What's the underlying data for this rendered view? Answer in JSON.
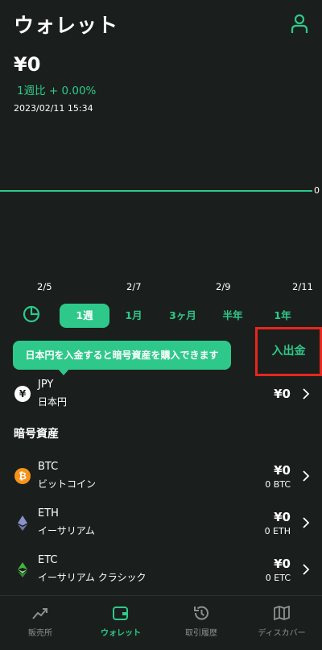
{
  "header": {
    "title": "ウォレット",
    "account_icon": "person-icon"
  },
  "summary": {
    "balance": "¥0",
    "weekly_change": "1週比 + 0.00%",
    "timestamp": "2023/02/11 15:34"
  },
  "chart": {
    "zero_label": "0",
    "x_ticks": [
      "2/5",
      "2/7",
      "2/9",
      "2/11"
    ]
  },
  "chart_data": {
    "type": "line",
    "x": [
      "2/5",
      "2/7",
      "2/9",
      "2/11"
    ],
    "series": [
      {
        "values": [
          0,
          0,
          0,
          0
        ]
      }
    ],
    "yticks": [
      "0"
    ]
  },
  "periods": {
    "pie_icon": "pie-chart-icon",
    "items": [
      "1週",
      "1月",
      "3ヶ月",
      "半年",
      "1年"
    ],
    "selected": "1週"
  },
  "tooltip": {
    "text": "日本円を入金すると暗号資産を購入できます"
  },
  "deposit": {
    "label": "入出金"
  },
  "jpy": {
    "symbol": "JPY",
    "name": "日本円",
    "amount": "¥0",
    "icon_glyph": "¥"
  },
  "crypto_section": {
    "title": "暗号資産"
  },
  "assets": [
    {
      "symbol": "BTC",
      "name": "ビットコイン",
      "amount": "¥0",
      "quantity": "0 BTC",
      "icon": "bitcoin-icon",
      "color": "#f7931a"
    },
    {
      "symbol": "ETH",
      "name": "イーサリアム",
      "amount": "¥0",
      "quantity": "0 ETH",
      "icon": "ethereum-icon",
      "color": "#8a93c9"
    },
    {
      "symbol": "ETC",
      "name": "イーサリアム クラシック",
      "amount": "¥0",
      "quantity": "0 ETC",
      "icon": "ethereum-classic-icon",
      "color": "#3ab83a"
    }
  ],
  "tabbar": {
    "items": [
      {
        "label": "販売所",
        "icon": "trend-chart-icon"
      },
      {
        "label": "ウォレット",
        "icon": "wallet-icon"
      },
      {
        "label": "取引履歴",
        "icon": "history-icon"
      },
      {
        "label": "ディスカバー",
        "icon": "map-icon"
      }
    ],
    "active": "ウォレット"
  },
  "colors": {
    "accent": "#2ec98a",
    "background": "#1a1f1d",
    "highlight_border": "#e8261c"
  }
}
